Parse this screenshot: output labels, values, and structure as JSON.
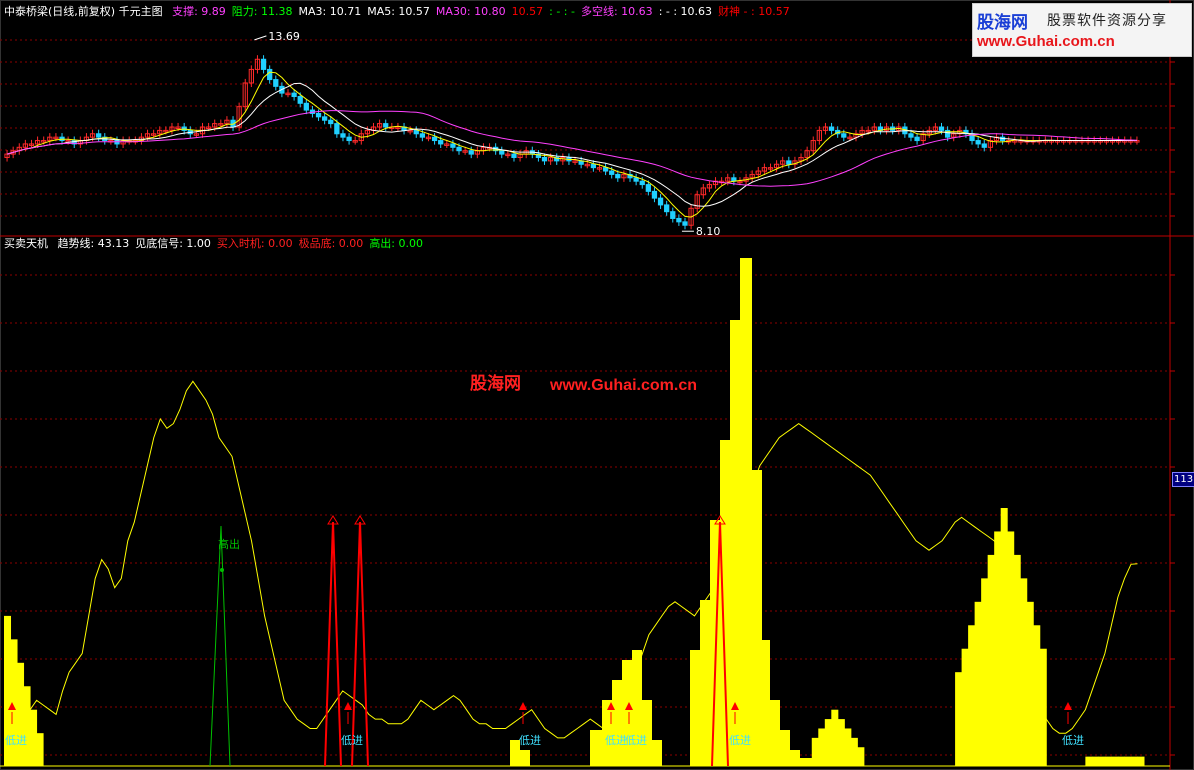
{
  "colors": {
    "background": "#000000",
    "grid": "#8b0000",
    "up_candle": "#ff2a2a",
    "down_candle": "#20d0ff",
    "ma_white": "#ffffff",
    "ma_yellow": "#ffff00",
    "ma_magenta": "#ff40ff",
    "trend_line": "#ffff00",
    "bars": "#ffff00",
    "signal_red": "#ff0000",
    "signal_green": "#00c000",
    "label_cyan": "#40e0ff"
  },
  "header_top": {
    "title": "中泰桥梁(日线,前复权) 千元主图",
    "items": [
      {
        "label": "支撑: 9.89",
        "color": "#ff40ff"
      },
      {
        "label": "阻力: 11.38",
        "color": "#00ff00"
      },
      {
        "label": "MA3: 10.71",
        "color": "#ffffff"
      },
      {
        "label": "MA5: 10.57",
        "color": "#ffffff"
      },
      {
        "label": "MA30: 10.80",
        "color": "#ff40ff"
      },
      {
        "label": "10.57",
        "color": "#ff0000"
      },
      {
        "label": ": -  : -",
        "color": "#00ff00"
      },
      {
        "label": "多空线: 10.63",
        "color": "#ff40ff"
      },
      {
        "label": ": -  : 10.63",
        "color": "#ffffff"
      },
      {
        "label": "财神 - : 10.57",
        "color": "#ff0000"
      }
    ]
  },
  "header_bottom": {
    "title": "买卖天机",
    "items": [
      {
        "label": "趋势线: 43.13",
        "color": "#ffffff"
      },
      {
        "label": "见底信号: 1.00",
        "color": "#ffffff"
      },
      {
        "label": "买入时机: 0.00",
        "color": "#ff2020"
      },
      {
        "label": "极品底: 0.00",
        "color": "#ff2020"
      },
      {
        "label": "高出: 0.00",
        "color": "#00ff00"
      }
    ]
  },
  "watermark": {
    "logo_line1": "股海网",
    "logo_line2": "股票软件资源分享",
    "logo_line3": "www.Guhai.com.cn",
    "center_cn": "股海网",
    "center_url": "www.Guhai.com.cn"
  },
  "annotations": {
    "high_label": "13.69",
    "low_label": "8.10",
    "right_price_box": "113",
    "signal_high": "高出",
    "signal_low": "低进"
  },
  "chart_data": [
    {
      "type": "candlestick",
      "title": "中泰桥梁(日线,前复权) 千元主图",
      "x": [
        1,
        2,
        3,
        4,
        5,
        6,
        7,
        8,
        9,
        10,
        11,
        12,
        13,
        14,
        15,
        16,
        17,
        18,
        19,
        20,
        21,
        22,
        23,
        24,
        25,
        26,
        27,
        28,
        29,
        30,
        31,
        32,
        33,
        34,
        35,
        36,
        37,
        38,
        39,
        40,
        41,
        42,
        43,
        44,
        45,
        46,
        47,
        48,
        49,
        50,
        51,
        52,
        53,
        54,
        55,
        56,
        57,
        58,
        59,
        60,
        61,
        62,
        63,
        64,
        65,
        66,
        67,
        68,
        69,
        70,
        71,
        72,
        73,
        74,
        75,
        76,
        77,
        78,
        79,
        80,
        81,
        82,
        83,
        84,
        85,
        86,
        87,
        88,
        89,
        90,
        91,
        92,
        93,
        94,
        95,
        96,
        97,
        98,
        99,
        100,
        101,
        102,
        103,
        104,
        105,
        106,
        107,
        108,
        109,
        110,
        111,
        112,
        113,
        114,
        115,
        116,
        117,
        118,
        119,
        120,
        121,
        122,
        123,
        124,
        125,
        126,
        127,
        128,
        129,
        130,
        131,
        132,
        133,
        134,
        135,
        136,
        137,
        138,
        139,
        140,
        141,
        142,
        143,
        144,
        145,
        146,
        147,
        148,
        149,
        150,
        151,
        152,
        153,
        154,
        155,
        156,
        157,
        158,
        159,
        160,
        161,
        162,
        163,
        164,
        165,
        166,
        167,
        168,
        169,
        170,
        171,
        172,
        173,
        174,
        175,
        176,
        177,
        178,
        179,
        180,
        181,
        182,
        183,
        184,
        185,
        186,
        187,
        188,
        189,
        190
      ],
      "close": [
        10.2,
        10.3,
        10.4,
        10.5,
        10.5,
        10.6,
        10.6,
        10.7,
        10.7,
        10.6,
        10.6,
        10.5,
        10.6,
        10.7,
        10.8,
        10.7,
        10.6,
        10.6,
        10.5,
        10.6,
        10.6,
        10.6,
        10.7,
        10.8,
        10.8,
        10.9,
        10.9,
        11.0,
        11.0,
        10.9,
        10.8,
        10.8,
        11.0,
        11.0,
        11.1,
        11.1,
        11.2,
        11.0,
        11.6,
        12.3,
        12.7,
        13.0,
        12.7,
        12.4,
        12.2,
        12.0,
        12.0,
        11.9,
        11.7,
        11.5,
        11.4,
        11.3,
        11.2,
        11.1,
        10.8,
        10.7,
        10.6,
        10.6,
        10.8,
        10.9,
        11.0,
        11.1,
        11.0,
        11.0,
        11.0,
        10.9,
        10.9,
        10.8,
        10.7,
        10.7,
        10.6,
        10.5,
        10.5,
        10.4,
        10.3,
        10.3,
        10.2,
        10.3,
        10.4,
        10.4,
        10.3,
        10.2,
        10.2,
        10.1,
        10.2,
        10.3,
        10.2,
        10.1,
        10.0,
        10.1,
        10.0,
        10.1,
        10.0,
        10.0,
        9.9,
        9.9,
        9.8,
        9.8,
        9.7,
        9.6,
        9.5,
        9.6,
        9.5,
        9.4,
        9.3,
        9.1,
        8.9,
        8.7,
        8.5,
        8.3,
        8.2,
        8.1,
        8.6,
        9.0,
        9.2,
        9.3,
        9.4,
        9.4,
        9.5,
        9.4,
        9.4,
        9.5,
        9.6,
        9.7,
        9.8,
        9.8,
        9.9,
        10.0,
        9.9,
        10.0,
        10.1,
        10.3,
        10.6,
        10.9,
        11.0,
        10.9,
        10.8,
        10.7,
        10.7,
        10.8,
        10.9,
        10.9,
        11.0,
        10.9,
        11.0,
        10.9,
        11.0,
        10.8,
        10.7,
        10.6,
        10.8,
        10.9,
        11.0,
        10.9,
        10.7,
        10.8,
        10.9,
        10.8,
        10.6,
        10.5,
        10.4,
        10.6,
        10.7,
        10.6,
        10.6,
        10.6,
        10.6,
        10.6,
        10.6,
        10.6,
        10.6,
        10.6,
        10.6,
        10.6,
        10.6,
        10.6,
        10.6,
        10.6,
        10.6,
        10.6,
        10.6,
        10.6,
        10.6,
        10.6,
        10.6,
        10.6
      ],
      "ylim": [
        7.9,
        14.1
      ],
      "high_label": 13.69,
      "low_label": 8.1
    },
    {
      "type": "line",
      "title": "买卖天机",
      "series": [
        {
          "name": "趋势线",
          "last": 43.13,
          "values": [
            10,
            10,
            9,
            8,
            12,
            14,
            13,
            12,
            11,
            16,
            20,
            22,
            24,
            32,
            40,
            44,
            42,
            38,
            40,
            48,
            52,
            58,
            64,
            70,
            74,
            72,
            73,
            76,
            80,
            82,
            80,
            78,
            75,
            70,
            68,
            66,
            60,
            54,
            48,
            40,
            32,
            26,
            20,
            14,
            12,
            10,
            9,
            8,
            8,
            10,
            12,
            14,
            16,
            15,
            14,
            13,
            11,
            10,
            10,
            9,
            9,
            9,
            10,
            12,
            14,
            13,
            12,
            13,
            14,
            15,
            14,
            12,
            10,
            9,
            9,
            8,
            8,
            8,
            9,
            10,
            11,
            12,
            10,
            8,
            7,
            6,
            6,
            7,
            8,
            9,
            10,
            9,
            8,
            9,
            10,
            13,
            16,
            20,
            24,
            28,
            30,
            32,
            34,
            35,
            34,
            33,
            32,
            34,
            36,
            38,
            40,
            42,
            44,
            48,
            54,
            60,
            64,
            66,
            68,
            70,
            71,
            72,
            73,
            72,
            71,
            70,
            69,
            68,
            67,
            66,
            65,
            64,
            63,
            62,
            60,
            58,
            56,
            54,
            52,
            50,
            48,
            47,
            46,
            47,
            48,
            50,
            52,
            53,
            52,
            51,
            50,
            49,
            48,
            46,
            42,
            36,
            30,
            24,
            18,
            14,
            10,
            8,
            7,
            7,
            8,
            10,
            12,
            16,
            20,
            24,
            30,
            36,
            40,
            43,
            43.13
          ]
        }
      ],
      "ylim": [
        0,
        110
      ]
    }
  ]
}
